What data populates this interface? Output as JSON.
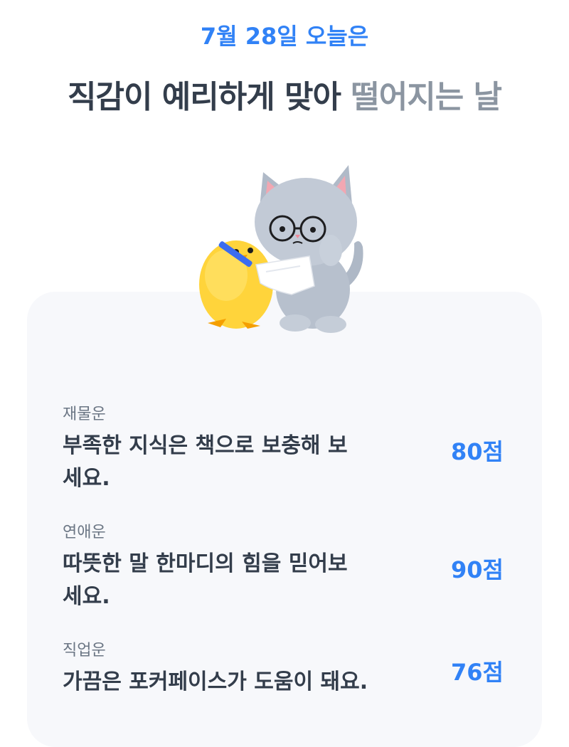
{
  "header": {
    "date_line": "7월 28일 오늘은",
    "headline_main": "직감이 예리하게 맞아 ",
    "headline_muted": "떨어지는 날"
  },
  "illustration": {
    "characters": [
      "chick-character",
      "cat-character"
    ],
    "colors": {
      "chick": "#ffd43b",
      "cat": "#aab4c3",
      "paper": "#ffffff",
      "pen": "#3b6cf0"
    }
  },
  "fortunes": [
    {
      "category": "재물운",
      "message": "부족한 지식은 책으로 보충해 보세요.",
      "score": "80점"
    },
    {
      "category": "연애운",
      "message": "따뜻한 말 한마디의 힘을 믿어보세요.",
      "score": "90점"
    },
    {
      "category": "직업운",
      "message": "가끔은 포커페이스가 도움이 돼요.",
      "score": "76점"
    }
  ],
  "colors": {
    "accent": "#3182f6",
    "text_primary": "#333d4b",
    "text_muted": "#8b95a1",
    "card_bg": "#f7f8fb"
  }
}
